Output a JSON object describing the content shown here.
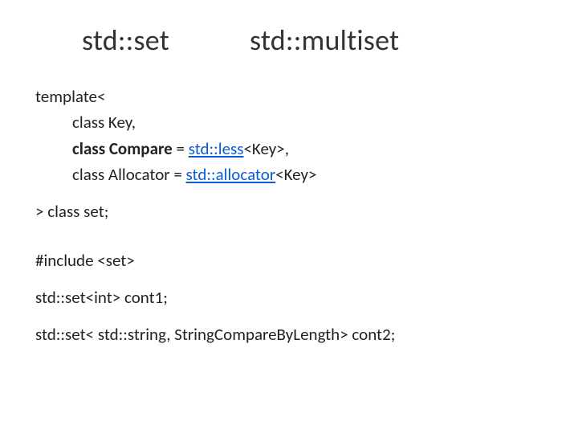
{
  "title": "std::set            std::multiset",
  "template_line": "template<",
  "param_key": "class Key,",
  "param_compare_prefix": "class Compare",
  "param_compare_eq": " = ",
  "param_compare_link": "std::less",
  "param_compare_suffix": "<Key>,",
  "param_alloc_prefix": "class Allocator = ",
  "param_alloc_link": "std::allocator",
  "param_alloc_suffix": "<Key>",
  "close_line": "> class set;",
  "include_line": "#include <set>",
  "decl1": "std::set<int>   cont1;",
  "decl2": "std::set< std::string, StringCompareByLength>  cont2;"
}
